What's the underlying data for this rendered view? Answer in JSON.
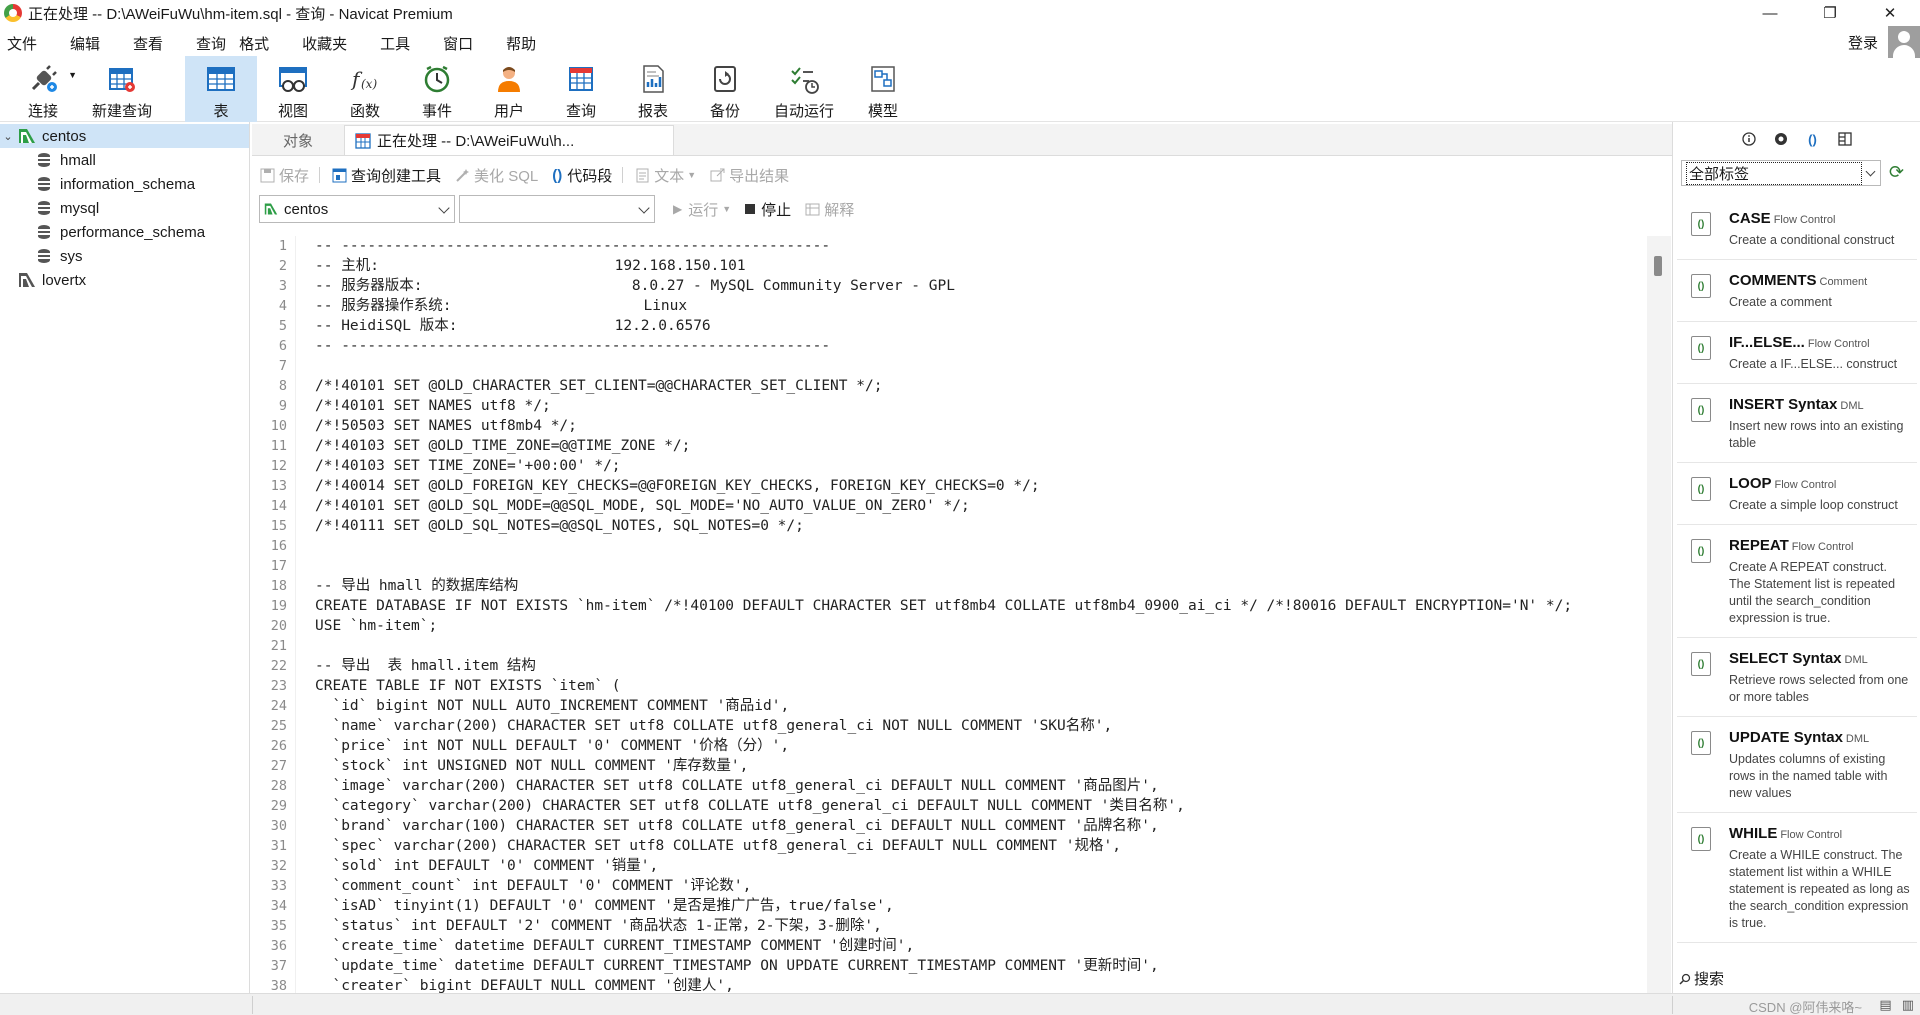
{
  "window": {
    "title": "正在处理 -- D:\\AWeiFuWu\\hm-item.sql - 查询 - Navicat Premium",
    "controls": [
      "—",
      "❐",
      "✕"
    ]
  },
  "menu": [
    "文件",
    "编辑",
    "查看",
    "查询",
    "格式",
    "收藏夹",
    "工具",
    "窗口",
    "帮助"
  ],
  "login_label": "登录",
  "toolbar": [
    {
      "label": "连接",
      "icon": "plug-icon"
    },
    {
      "label": "新建查询",
      "icon": "new-query-icon"
    },
    {
      "label": "表",
      "icon": "table-icon",
      "active": true
    },
    {
      "label": "视图",
      "icon": "view-icon"
    },
    {
      "label": "函数",
      "icon": "function-icon"
    },
    {
      "label": "事件",
      "icon": "clock-icon"
    },
    {
      "label": "用户",
      "icon": "user-icon"
    },
    {
      "label": "查询",
      "icon": "query-icon"
    },
    {
      "label": "报表",
      "icon": "report-icon"
    },
    {
      "label": "备份",
      "icon": "backup-icon"
    },
    {
      "label": "自动运行",
      "icon": "schedule-icon"
    },
    {
      "label": "模型",
      "icon": "model-icon"
    }
  ],
  "navigator": {
    "connections": [
      {
        "name": "centos",
        "expanded": true,
        "databases": [
          "hmall",
          "information_schema",
          "mysql",
          "performance_schema",
          "sys"
        ]
      },
      {
        "name": "lovertx",
        "expanded": false,
        "databases": []
      }
    ]
  },
  "tabs": {
    "objects": "对象",
    "query": "正在处理 -- D:\\AWeiFuWu\\h..."
  },
  "query_toolbar": {
    "save": "保存",
    "builder": "查询创建工具",
    "beautify": "美化 SQL",
    "snippet": "代码段",
    "text": "文本",
    "export": "导出结果",
    "run": "运行",
    "stop": "停止",
    "explain": "解释"
  },
  "connection_select": "centos",
  "database_select": "",
  "editor": {
    "lines": [
      "-- --------------------------------------------------------",
      "-- 主机:                           192.168.150.101",
      "-- 服务器版本:                        8.0.27 - MySQL Community Server - GPL",
      "-- 服务器操作系统:                      Linux",
      "-- HeidiSQL 版本:                  12.2.0.6576",
      "-- --------------------------------------------------------",
      "",
      "/*!40101 SET @OLD_CHARACTER_SET_CLIENT=@@CHARACTER_SET_CLIENT */;",
      "/*!40101 SET NAMES utf8 */;",
      "/*!50503 SET NAMES utf8mb4 */;",
      "/*!40103 SET @OLD_TIME_ZONE=@@TIME_ZONE */;",
      "/*!40103 SET TIME_ZONE='+00:00' */;",
      "/*!40014 SET @OLD_FOREIGN_KEY_CHECKS=@@FOREIGN_KEY_CHECKS, FOREIGN_KEY_CHECKS=0 */;",
      "/*!40101 SET @OLD_SQL_MODE=@@SQL_MODE, SQL_MODE='NO_AUTO_VALUE_ON_ZERO' */;",
      "/*!40111 SET @OLD_SQL_NOTES=@@SQL_NOTES, SQL_NOTES=0 */;",
      "",
      "",
      "-- 导出 hmall 的数据库结构",
      "CREATE DATABASE IF NOT EXISTS `hm-item` /*!40100 DEFAULT CHARACTER SET utf8mb4 COLLATE utf8mb4_0900_ai_ci */ /*!80016 DEFAULT ENCRYPTION='N' */;",
      "USE `hm-item`;",
      "",
      "-- 导出  表 hmall.item 结构",
      "CREATE TABLE IF NOT EXISTS `item` (",
      "  `id` bigint NOT NULL AUTO_INCREMENT COMMENT '商品id',",
      "  `name` varchar(200) CHARACTER SET utf8 COLLATE utf8_general_ci NOT NULL COMMENT 'SKU名称',",
      "  `price` int NOT NULL DEFAULT '0' COMMENT '价格（分）',",
      "  `stock` int UNSIGNED NOT NULL COMMENT '库存数量',",
      "  `image` varchar(200) CHARACTER SET utf8 COLLATE utf8_general_ci DEFAULT NULL COMMENT '商品图片',",
      "  `category` varchar(200) CHARACTER SET utf8 COLLATE utf8_general_ci DEFAULT NULL COMMENT '类目名称',",
      "  `brand` varchar(100) CHARACTER SET utf8 COLLATE utf8_general_ci DEFAULT NULL COMMENT '品牌名称',",
      "  `spec` varchar(200) CHARACTER SET utf8 COLLATE utf8_general_ci DEFAULT NULL COMMENT '规格',",
      "  `sold` int DEFAULT '0' COMMENT '销量',",
      "  `comment_count` int DEFAULT '0' COMMENT '评论数',",
      "  `isAD` tinyint(1) DEFAULT '0' COMMENT '是否是推广广告，true/false',",
      "  `status` int DEFAULT '2' COMMENT '商品状态 1-正常，2-下架，3-删除',",
      "  `create_time` datetime DEFAULT CURRENT_TIMESTAMP COMMENT '创建时间',",
      "  `update_time` datetime DEFAULT CURRENT_TIMESTAMP ON UPDATE CURRENT_TIMESTAMP COMMENT '更新时间',",
      "  `creater` bigint DEFAULT NULL COMMENT '创建人',"
    ]
  },
  "snippets_panel": {
    "filter": "全部标签",
    "search_label": "搜索",
    "items": [
      {
        "title": "CASE",
        "category": "Flow Control",
        "desc": "Create a conditional construct"
      },
      {
        "title": "COMMENTS",
        "category": "Comment",
        "desc": "Create a comment"
      },
      {
        "title": "IF...ELSE...",
        "category": "Flow Control",
        "desc": "Create a IF...ELSE... construct"
      },
      {
        "title": "INSERT Syntax",
        "category": "DML",
        "desc": "Insert new rows into an existing table"
      },
      {
        "title": "LOOP",
        "category": "Flow Control",
        "desc": "Create a simple loop construct"
      },
      {
        "title": "REPEAT",
        "category": "Flow Control",
        "desc": "Create A REPEAT construct. The Statement list is repeated until the search_condition expression is true."
      },
      {
        "title": "SELECT Syntax",
        "category": "DML",
        "desc": "Retrieve rows selected from one or more tables"
      },
      {
        "title": "UPDATE Syntax",
        "category": "DML",
        "desc": "Updates columns of existing rows in the named table with new values"
      },
      {
        "title": "WHILE",
        "category": "Flow Control",
        "desc": "Create a WHILE construct. The statement list within a WHILE statement is repeated as long as the search_condition expression is true."
      }
    ]
  },
  "watermark": "CSDN @阿伟来咯~"
}
